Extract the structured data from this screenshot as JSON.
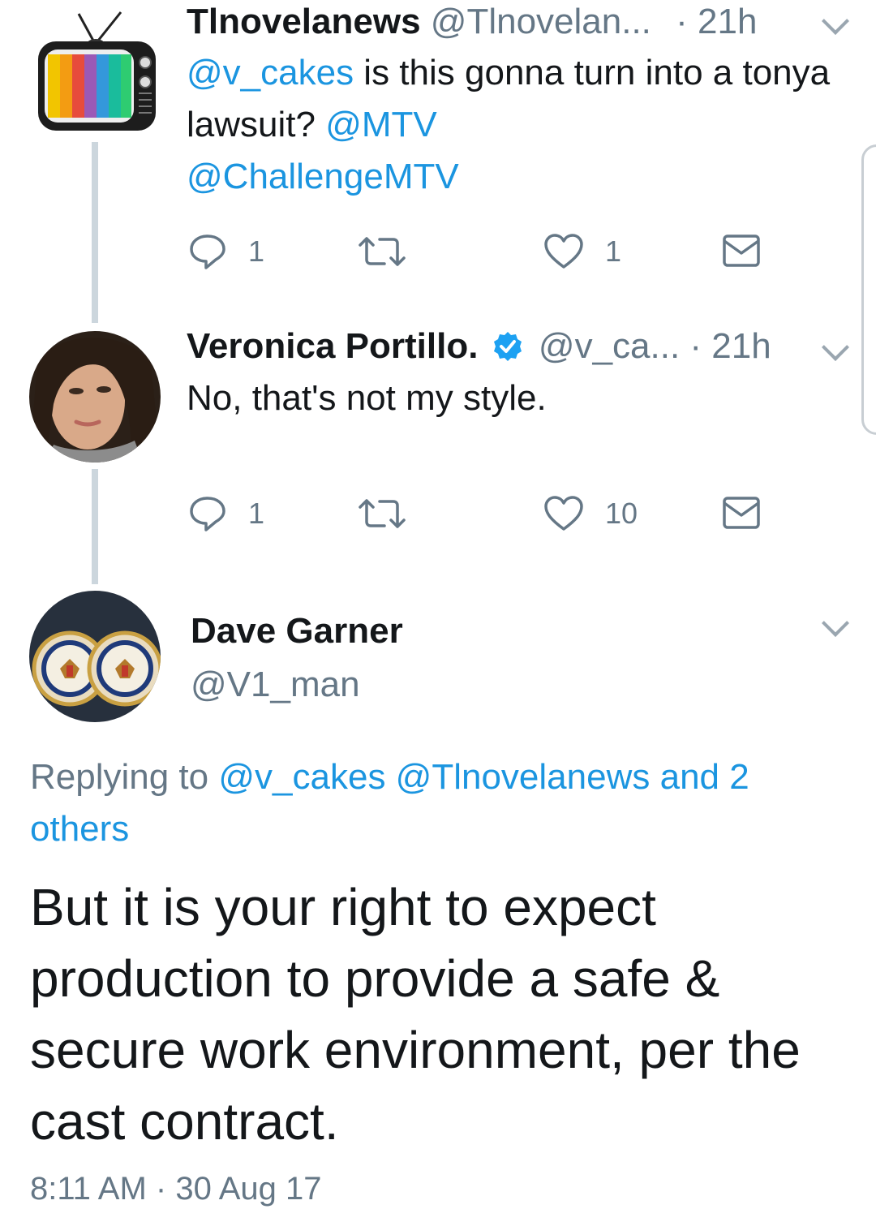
{
  "colors": {
    "link": "#1b95e0",
    "muted": "#657786",
    "thread": "#ccd6dd",
    "verified": "#1da1f2"
  },
  "tweets": [
    {
      "display_name": "Tlnovelanews",
      "handle": "@Tlnovelan...",
      "time": "· 21h",
      "body": {
        "mention1": "@v_cakes",
        "text1": " is this gonna turn into a tonya lawsuit? ",
        "mention2": "@MTV",
        "mention3": "@ChallengeMTV"
      },
      "replies": "1",
      "retweets": "",
      "likes": "1",
      "avatar_icon": "tv-icon"
    },
    {
      "display_name": "Veronica Portillo.",
      "handle": "@v_ca...",
      "time": "· 21h",
      "body": {
        "text1": "No, that's not my style."
      },
      "replies": "1",
      "retweets": "",
      "likes": "10",
      "verified": true
    }
  ],
  "main": {
    "display_name": "Dave Garner",
    "handle": "@V1_man",
    "replying_prefix": "Replying to ",
    "replying_mention1": "@v_cakes",
    "replying_mention2": "@Tlnovelanews",
    "replying_suffix": " and 2 others",
    "text": "But it is your right to expect production to provide a safe & secure work environment, per the cast contract.",
    "timestamp": "8:11 AM · 30 Aug 17"
  }
}
